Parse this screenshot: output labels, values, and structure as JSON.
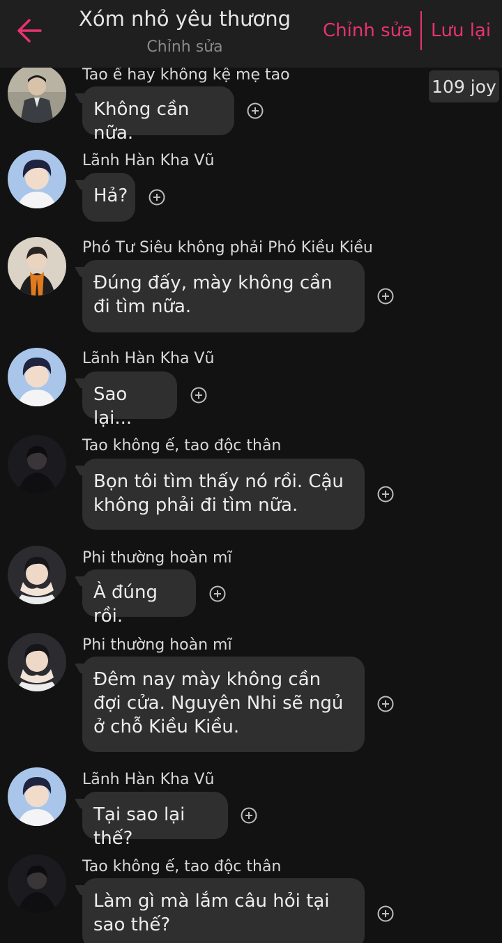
{
  "header": {
    "title": "Xóm nhỏ yêu thương",
    "subtitle": "Chỉnh sửa",
    "edit_label": "Chỉnh sửa",
    "save_label": "Lưu lại",
    "accent_color": "#e8336e"
  },
  "joy_badge": "109 joy",
  "messages": [
    {
      "sender": "Tao ế hay không kệ mẹ tao",
      "text": "Không cần nữa.",
      "avatar": "avatar-suit"
    },
    {
      "sender": "Lãnh Hàn Kha Vũ",
      "text": "Hả?",
      "avatar": "avatar-blue"
    },
    {
      "sender": "Phó Tư Siêu không phải Phó Kiều Kiều",
      "text": "Đúng đấy, mày không cần đi tìm nữa.",
      "avatar": "avatar-orange-scarf"
    },
    {
      "sender": "Lãnh Hàn Kha Vũ",
      "text": "Sao lại...",
      "avatar": "avatar-blue"
    },
    {
      "sender": "Tao không ế, tao độc thân",
      "text": "Bọn tôi tìm thấy nó rồi. Cậu không phải đi tìm nữa.",
      "avatar": "avatar-dark"
    },
    {
      "sender": "Phi thường hoàn mĩ",
      "text": "À đúng rồi.",
      "avatar": "avatar-hands"
    },
    {
      "sender": "Phi thường hoàn mĩ",
      "text": "Đêm nay mày không cần đợi cửa. Nguyên Nhi sẽ ngủ ở chỗ Kiều Kiều.",
      "avatar": "avatar-hands"
    },
    {
      "sender": "Lãnh Hàn Kha Vũ",
      "text": "Tại sao lại thế?",
      "avatar": "avatar-blue"
    },
    {
      "sender": "Tao không ế, tao độc thân",
      "text": "Làm gì mà lắm câu hỏi tại sao thế?",
      "avatar": "avatar-dark"
    }
  ]
}
